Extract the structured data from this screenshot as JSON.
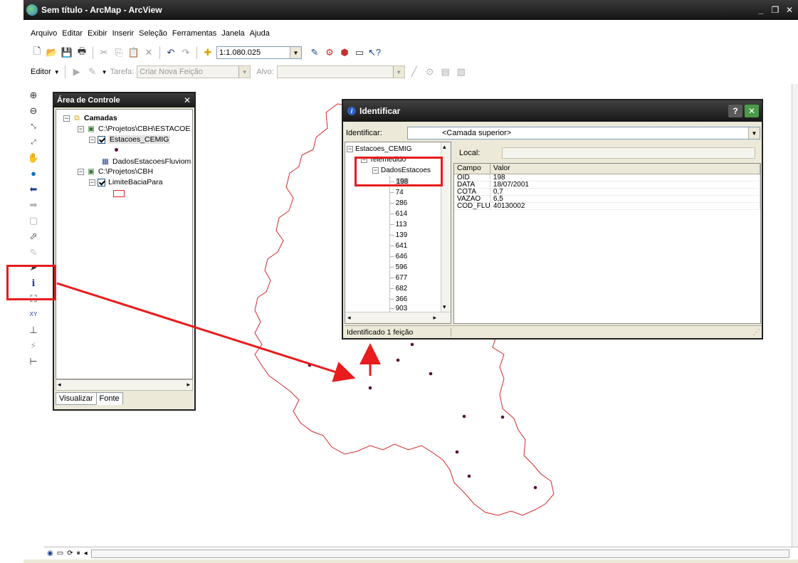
{
  "window": {
    "title": "Sem título - ArcMap - ArcView"
  },
  "menu": [
    "Arquivo",
    "Editar",
    "Exibir",
    "Inserir",
    "Seleção",
    "Ferramentas",
    "Janela",
    "Ajuda"
  ],
  "toolbar": {
    "scale": "1:1.080.025"
  },
  "editor": {
    "editor_label": "Editor",
    "task_label": "Tarefa:",
    "task_value": "Criar Nova Feição",
    "target_label": "Alvo:"
  },
  "control": {
    "title": "Área de Controle",
    "root": "Camadas",
    "group1": "C:\\Projetos\\CBH\\ESTACOE",
    "layer1": "Estacoes_CEMIG",
    "table1": "DadosEstacoesFluviom",
    "group2": "C:\\Projetos\\CBH",
    "layer2": "LimiteBaciaPara",
    "tabs": [
      "Visualizar",
      "Fonte"
    ]
  },
  "identify": {
    "title": "Identificar",
    "identify_label": "Identificar:",
    "identify_value": "<Camada superior>",
    "location_label": "Local:",
    "tree_root": "Estacoes_CEMIG",
    "tree_child": "Telemedido",
    "tree_grandchild": "DadosEstacoes",
    "ids": [
      "198",
      "74",
      "286",
      "614",
      "113",
      "139",
      "641",
      "646",
      "596",
      "677",
      "682",
      "366",
      "903"
    ],
    "columns": [
      "Campo",
      "Valor"
    ],
    "rows": [
      [
        "OID",
        "198"
      ],
      [
        "DATA",
        "18/07/2001"
      ],
      [
        "COTA",
        "0,7"
      ],
      [
        "VAZAO",
        "6,5"
      ],
      [
        "COD_FLU",
        "40130002"
      ]
    ],
    "status": "Identificado 1 feição"
  },
  "colors": {
    "accent": "#e81c1c",
    "boundary": "#d6282a",
    "point": "#5a0f3c"
  }
}
